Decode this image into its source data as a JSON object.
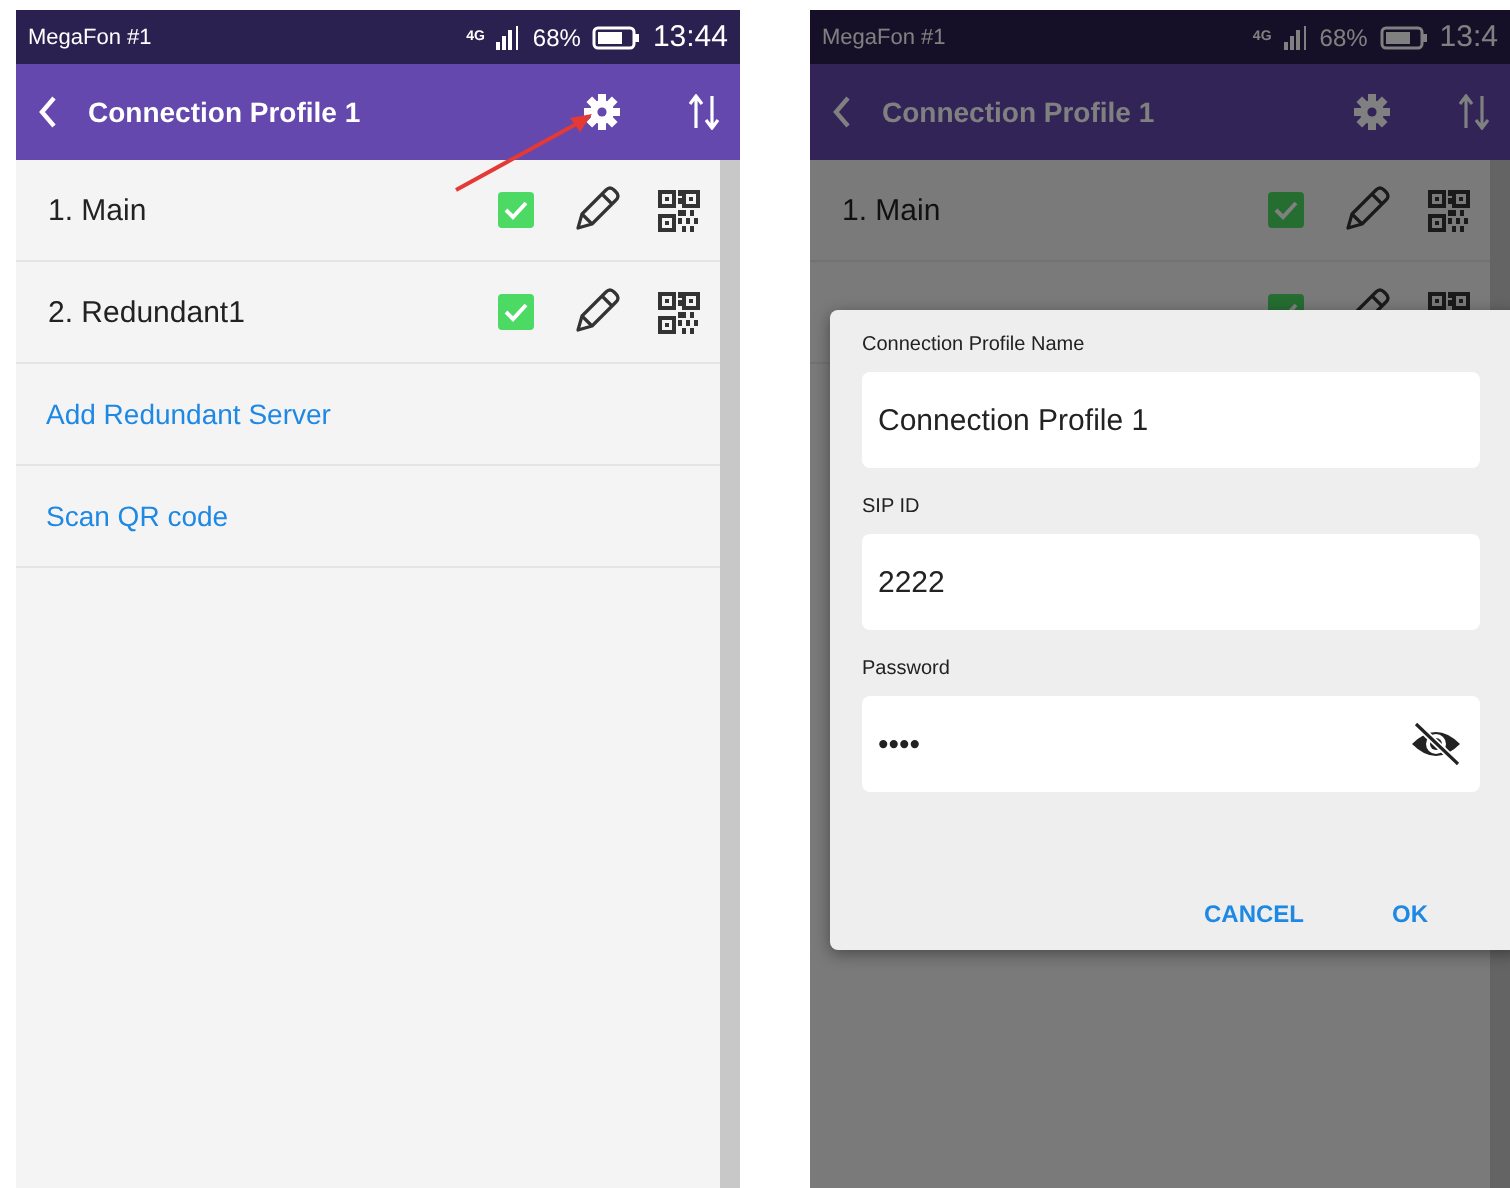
{
  "screens": [
    {
      "dimmed": false,
      "status_bar": {
        "carrier": "MegaFon #1",
        "network": "4G",
        "battery": "68%",
        "time": "13:44"
      },
      "app_bar": {
        "title": "Connection Profile 1"
      },
      "servers": [
        {
          "label": "1. Main",
          "enabled": true
        },
        {
          "label": "2. Redundant1",
          "enabled": true
        }
      ],
      "links": [
        "Add Redundant Server",
        "Scan QR code"
      ],
      "annotation": {
        "kind": "arrow"
      }
    },
    {
      "dimmed": true,
      "status_bar": {
        "carrier": "MegaFon #1",
        "network": "4G",
        "battery": "68%",
        "time": "13:4"
      },
      "app_bar": {
        "title": "Connection Profile 1"
      },
      "servers": [
        {
          "label": "1. Main",
          "enabled": true
        },
        {
          "enabled": true
        }
      ],
      "dialog": {
        "fields": [
          {
            "kind": "text",
            "label": "Connection Profile Name",
            "value": "Connection Profile 1"
          },
          {
            "kind": "text",
            "label": "SIP ID",
            "value": "2222"
          },
          {
            "kind": "password",
            "label": "Password",
            "value": "••••"
          }
        ],
        "buttons": [
          "CANCEL",
          "OK"
        ]
      }
    }
  ]
}
